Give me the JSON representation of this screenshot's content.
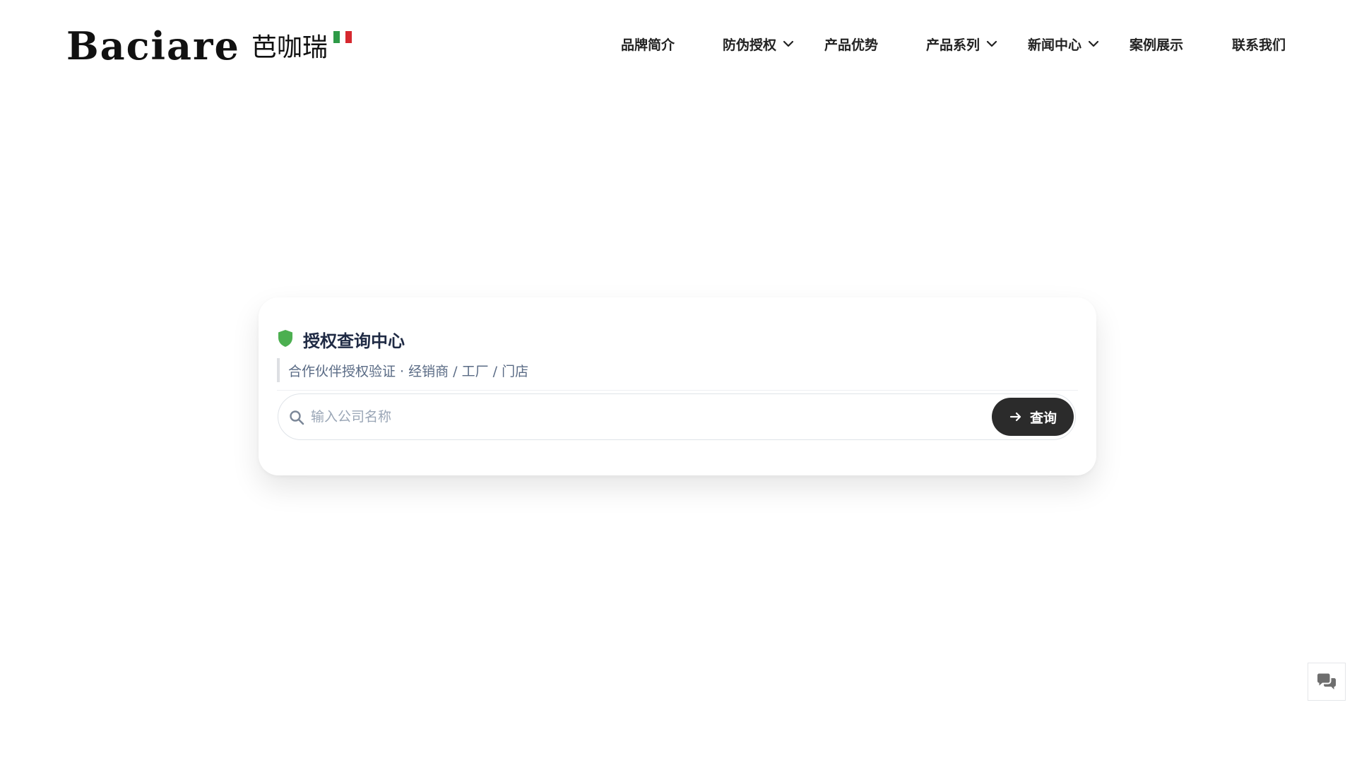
{
  "brand": {
    "name_latin": "Baciare",
    "name_cn": "芭咖瑞",
    "flag_colors": [
      "#2e9a47",
      "#ffffff",
      "#d6282f"
    ]
  },
  "nav": {
    "items": [
      {
        "label": "品牌简介",
        "has_dropdown": false
      },
      {
        "label": "防伪授权",
        "has_dropdown": true
      },
      {
        "label": "产品优势",
        "has_dropdown": false
      },
      {
        "label": "产品系列",
        "has_dropdown": true
      },
      {
        "label": "新闻中心",
        "has_dropdown": true
      },
      {
        "label": "案例展示",
        "has_dropdown": false
      },
      {
        "label": "联系我们",
        "has_dropdown": false
      }
    ]
  },
  "auth_card": {
    "title": "授权查询中心",
    "subtitle": "合作伙伴授权验证 · 经销商 / 工厂 / 门店",
    "search": {
      "placeholder": "输入公司名称",
      "value": "",
      "button_label": "查询"
    },
    "accent_color": "#4caf50"
  },
  "colors": {
    "text_dark": "#1f2a44",
    "subtitle": "#5a6b85",
    "button_bg": "#2b2b2b"
  },
  "icons": {
    "shield": "shield-icon",
    "search": "search-icon",
    "arrow": "arrow-right-icon",
    "chat": "chat-bubbles-icon",
    "chevron": "chevron-down-icon"
  }
}
